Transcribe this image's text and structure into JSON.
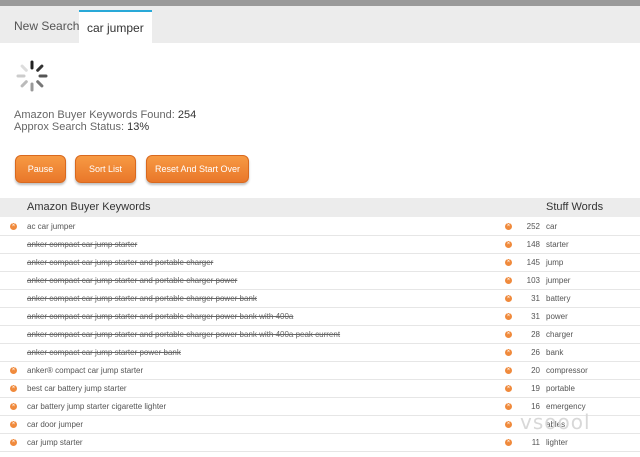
{
  "tabs": [
    {
      "label": "New Search"
    },
    {
      "label": "car jumper"
    }
  ],
  "status": {
    "found_label": "Amazon Buyer Keywords Found:",
    "found_value": "254",
    "status_label": "Approx Search Status:",
    "status_value": "13%"
  },
  "buttons": {
    "pause": "Pause",
    "sort": "Sort List",
    "reset": "Reset And Start Over"
  },
  "table": {
    "left_header": "Amazon Buyer Keywords",
    "right_header": "Stuff Words",
    "rows": [
      {
        "keyword": "ac car jumper",
        "struck": false,
        "count": "252",
        "word": "car"
      },
      {
        "keyword": "anker compact car jump starter",
        "struck": true,
        "count": "148",
        "word": "starter"
      },
      {
        "keyword": "anker compact car jump starter and portable charger",
        "struck": true,
        "count": "145",
        "word": "jump"
      },
      {
        "keyword": "anker compact car jump starter and portable charger power",
        "struck": true,
        "count": "103",
        "word": "jumper"
      },
      {
        "keyword": "anker compact car jump starter and portable charger power bank",
        "struck": true,
        "count": "31",
        "word": "battery"
      },
      {
        "keyword": "anker compact car jump starter and portable charger power bank with 400a",
        "struck": true,
        "count": "31",
        "word": "power"
      },
      {
        "keyword": "anker compact car jump starter and portable charger power bank with 400a peak current",
        "struck": true,
        "count": "28",
        "word": "charger"
      },
      {
        "keyword": "anker compact car jump starter power bank",
        "struck": true,
        "count": "26",
        "word": "bank"
      },
      {
        "keyword": "anker® compact car jump starter",
        "struck": false,
        "count": "20",
        "word": "compressor"
      },
      {
        "keyword": "best car battery jump starter",
        "struck": false,
        "count": "19",
        "word": "portable"
      },
      {
        "keyword": "car battery jump starter cigarette lighter",
        "struck": false,
        "count": "16",
        "word": "emergency"
      },
      {
        "keyword": "car door jumper",
        "struck": false,
        "count": "",
        "word": "ables"
      },
      {
        "keyword": "car jump starter",
        "struck": false,
        "count": "11",
        "word": "lighter"
      }
    ]
  },
  "watermark": "vsoool"
}
